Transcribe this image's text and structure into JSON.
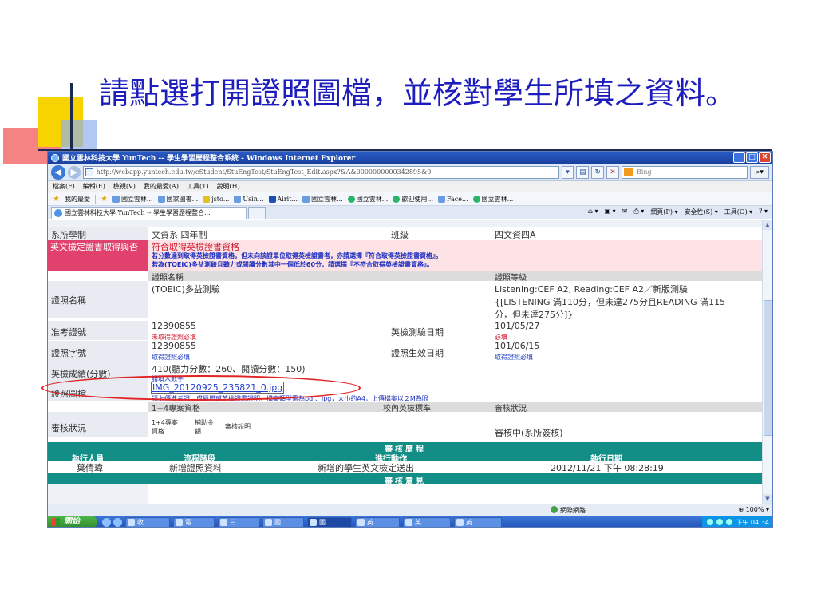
{
  "slide": {
    "title": "請點選打開證照圖檔，並核對學生所填之資料。"
  },
  "browser": {
    "window_title": "國立雲林科技大學 YunTech -- 學生學習歷程整合系統 - Windows Internet Explorer",
    "address_url": "http://webapp.yuntech.edu.tw/eStudent/StuEngTest/StuEngTest_Edit.aspx?&A&0000000000342895&0",
    "search_placeholder": "Bing",
    "menu": [
      "檔案(F)",
      "編輯(E)",
      "檢視(V)",
      "我的最愛(A)",
      "工具(T)",
      "說明(H)"
    ],
    "favorites_label": "我的最愛",
    "favorites": [
      "國立雲林...",
      "國家圖書...",
      "jsto...",
      "Usin...",
      "Airit...",
      "國立雲林...",
      "國立雲林...",
      "歡迎使用...",
      "Face...",
      "國立雲林..."
    ],
    "tab_title": "國立雲林科技大學 YunTech -- 學生學習歷程整合...",
    "command_bar": [
      "網頁(P) ▾",
      "安全性(S) ▾",
      "工具(O) ▾"
    ]
  },
  "form": {
    "top_cut_left": "",
    "dept_label": "系所學制",
    "dept_value": "文資系 四年制",
    "class_label": "班級",
    "class_value": "四文資四A",
    "english_cert_label": "英文檢定證書取得與否",
    "english_cert_value": "符合取得英檢證書資格",
    "english_cert_note1": "若分數達到取得英檢證書資格，但未向該證單位取得英檢證書者，亦請選擇『符合取得英檢證書資格』。",
    "english_cert_note2": "若為(TOEIC)多益測驗且聽力或閱讀分數其中一個低於60分，請選擇『不符合取得英檢證書資格』。",
    "cert_name_header": "證照名稱",
    "cert_level_header": "證照等級",
    "cert_name_label": "證照名稱",
    "cert_name_value": "(TOEIC)多益測驗",
    "cert_level_line1": "Listening:CEF A2, Reading:CEF A2／新版測驗",
    "cert_level_line2": "{[LISTENING 滿110分，但未達275分且READING 滿115",
    "cert_level_line3": "分，但未達275分]}",
    "exam_no_label": "准考證號",
    "exam_no_value": "12390855",
    "exam_no_note": "未取得證照必填",
    "exam_date_label": "英檢測驗日期",
    "exam_date_value": "101/05/27",
    "exam_date_note": "必填",
    "cert_no_label": "證照字號",
    "cert_no_value": "12390855",
    "cert_no_note": "取得證照必填",
    "cert_valid_label": "證照生效日期",
    "cert_valid_value": "101/06/15",
    "cert_valid_note": "取得證照必填",
    "score_label": "英檢成績(分數)",
    "score_value": "410(聽力分數：260、閱讀分數：150)",
    "score_note": "請填入數字",
    "image_label": "證照圖檔",
    "image_file": "IMG_20120925_235821_0.jpg",
    "image_note": "請上傳准考證、成績單或英檢證書證明，檔案類型需為pdf、jpg，大小約A4，上傳檔案以２M為限",
    "review_header_left": "1+4專案資格",
    "review_header_mid": "校內英檢標準",
    "review_header_right": "審核狀況",
    "review_label": "審核狀況",
    "review_col1": "1+4專案資格",
    "review_col2": "補助金額",
    "review_col3": "審核說明",
    "review_status": "審核中(系所簽核)"
  },
  "history": {
    "title": "審核歷程",
    "headers": [
      "執行人員",
      "流程階段",
      "進行動作",
      "執行日期"
    ],
    "rows": [
      [
        "葉倩瑋",
        "新增證照資料",
        "新增的學生英文檢定送出",
        "2012/11/21 下午 08:28:19"
      ]
    ],
    "opinion_title": "審核意見"
  },
  "status_bar": {
    "zone": "網際網路",
    "zoom": "100%"
  },
  "taskbar": {
    "start": "開始",
    "buttons": [
      "收...",
      "電...",
      "三...",
      "國...",
      "國...",
      "英...",
      "英...",
      "英..."
    ],
    "clock": "下午 04:34"
  },
  "colors": {
    "title_blue": "#1d1dbd",
    "teal": "#138e86",
    "alert_red": "#d1162a",
    "annotation_red": "#e32222"
  }
}
